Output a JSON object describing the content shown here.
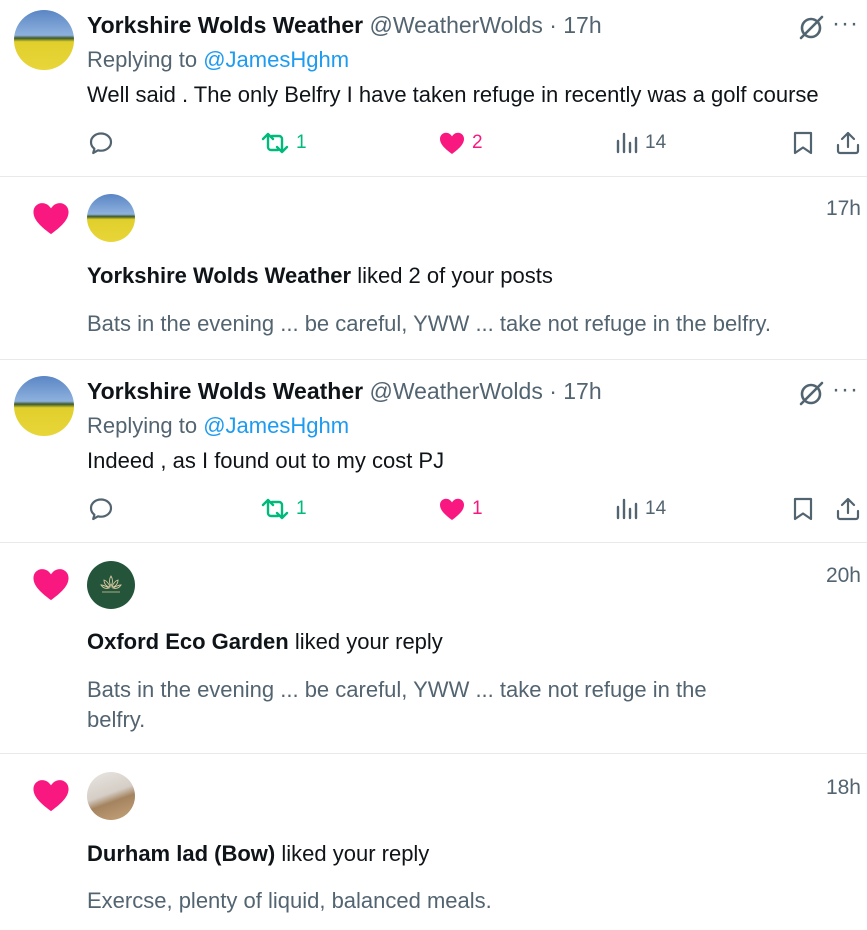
{
  "tweets": [
    {
      "name": "Yorkshire Wolds Weather",
      "handle": "@WeatherWolds",
      "time": "· 17h",
      "replying_prefix": "Replying to",
      "replying_handle": "@JamesHghm",
      "text": "Well said . The only Belfry I have taken refuge in recently was a golf course",
      "retweets": "1",
      "likes": "2",
      "views": "14",
      "more": "···"
    },
    {
      "name": "Yorkshire Wolds Weather",
      "handle": "@WeatherWolds",
      "time": "· 17h",
      "replying_prefix": "Replying to",
      "replying_handle": "@JamesHghm",
      "text": "Indeed , as I found out to my cost PJ",
      "retweets": "1",
      "likes": "1",
      "views": "14",
      "more": "···"
    }
  ],
  "notifications": [
    {
      "time": "17h",
      "actor": "Yorkshire Wolds Weather",
      "action": "liked 2 of your posts",
      "snippet": "Bats in the evening ... be careful, YWW ... take not refuge in the belfry."
    },
    {
      "time": "20h",
      "actor": "Oxford Eco Garden",
      "action": "liked your reply",
      "snippet": "Bats in the evening ... be careful, YWW ... take not refuge in the belfry."
    },
    {
      "time": "18h",
      "actor": "Durham lad (Bow)",
      "action": "liked your reply",
      "snippet": "Exercse, plenty of liquid, balanced meals."
    }
  ],
  "colors": {
    "like": "#f91880",
    "retweet": "#00ba7c",
    "link": "#1d9bf0",
    "muted": "#536471"
  },
  "icons": [
    "reply-icon",
    "retweet-icon",
    "heart-icon",
    "views-icon",
    "bookmark-icon",
    "share-icon",
    "grok-icon",
    "more-icon"
  ]
}
